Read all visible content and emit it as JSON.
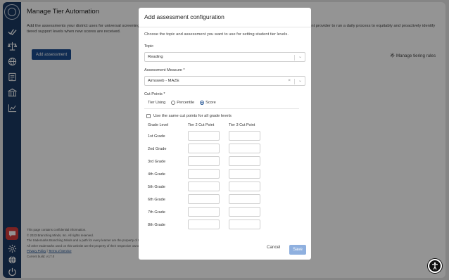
{
  "page": {
    "title": "Manage Tier Automation",
    "description": "Add the assessments your district uses for universal screening. Branching Minds will use these assessments to send an automated request to your assessment provider to run a daily process to equitably and proactively identify tiered support levels when new scores are received.",
    "add_button": "Add assessment",
    "manage_rules": "Manage tiering rules"
  },
  "footer": {
    "line1": "This page contains confidential information.",
    "line2": "© 2023 Branching Minds, Inc. All rights reserved.",
    "line3": "The trademarks Branching Minds and a path for every learner are the property of Branching Minds, Inc.",
    "line4": "All other trademarks used on this website are the property of their respective owners.",
    "privacy": "Privacy Policy",
    "separator": " | ",
    "terms": "Terms of Service",
    "build": "Current build: v.17.0"
  },
  "sidebar": {
    "icons": [
      "logo-icon",
      "checkmark-icon",
      "scale-icon",
      "globe-icon",
      "document-icon",
      "building-icon",
      "chart-icon",
      "chat-icon",
      "gear-icon",
      "language-icon",
      "power-icon"
    ]
  },
  "modal": {
    "title": "Add assessment configuration",
    "subtitle": "Choose the topic and assessment you want to use for setting student tier levels.",
    "topic_label": "Topic",
    "topic_value": "Reading",
    "measure_label": "Assessment Measure *",
    "measure_value": "Aimsweb - MAZE",
    "cut_points_label": "Cut Points *",
    "tier_using_label": "Tier Using",
    "percentile_label": "Percentile",
    "score_label": "Score",
    "selected_tier_using": "Score",
    "same_cut_points_label": "Use the same cut points for all grade levels",
    "col_grade": "Grade Level",
    "col_tier2": "Tier 2 Cut Point",
    "col_tier3": "Tier 3 Cut Point",
    "grades": [
      "1st Grade",
      "2nd Grade",
      "3rd Grade",
      "4th Grade",
      "5th Grade",
      "6th Grade",
      "7th Grade",
      "8th Grade"
    ],
    "cancel": "Cancel",
    "save": "Save"
  },
  "colors": {
    "sidebar": "#1a3a63",
    "primary_button": "#1a4d8f",
    "save_disabled": "#8fb0df",
    "chat_button": "#d63b3b"
  }
}
